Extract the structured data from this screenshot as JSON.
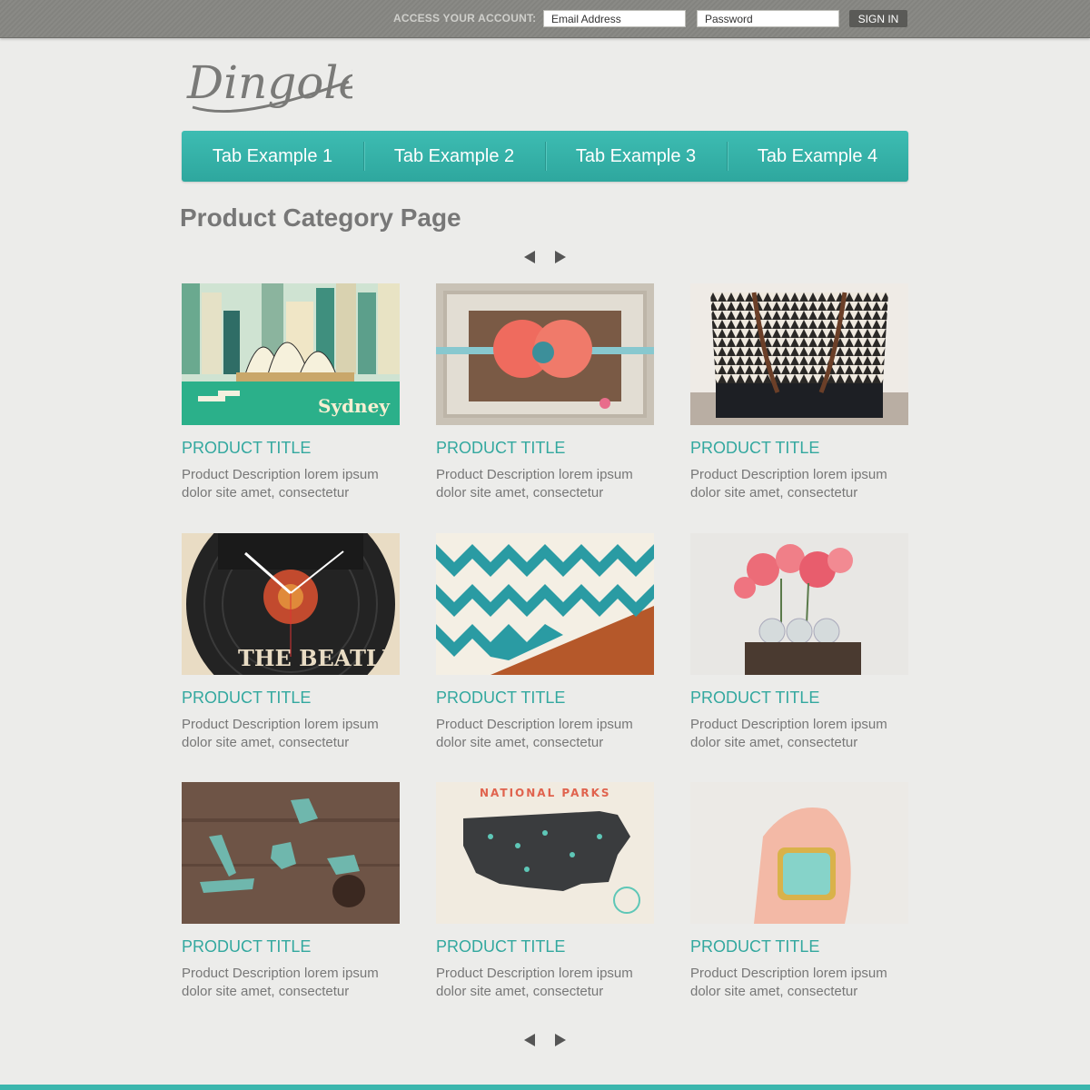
{
  "account": {
    "label": "ACCESS YOUR ACCOUNT:",
    "email_placeholder": "Email Address",
    "password_placeholder": "Password",
    "signin_label": "SIGN IN"
  },
  "brand": {
    "logo_text": "Dingolé"
  },
  "nav": {
    "tabs": [
      {
        "label": "Tab Example 1"
      },
      {
        "label": "Tab Example 2"
      },
      {
        "label": "Tab Example 3"
      },
      {
        "label": "Tab Example 4"
      }
    ]
  },
  "page": {
    "title": "Product Category Page"
  },
  "colors": {
    "accent": "#33a89f",
    "nav": "#35b2a8"
  },
  "products": [
    {
      "title": "PRODUCT TITLE",
      "desc": "Product Description lorem ipsum dolor site amet, consectetur",
      "image": "sydney-poster",
      "image_caption": "Sydney"
    },
    {
      "title": "PRODUCT TITLE",
      "desc": "Product Description lorem ipsum dolor site amet, consectetur",
      "image": "flower-headband"
    },
    {
      "title": "PRODUCT TITLE",
      "desc": "Product Description lorem ipsum dolor site amet, consectetur",
      "image": "tote-bag"
    },
    {
      "title": "PRODUCT TITLE",
      "desc": "Product Description lorem ipsum dolor site amet, consectetur",
      "image": "record-clock",
      "image_caption": "THE BEATLES"
    },
    {
      "title": "PRODUCT TITLE",
      "desc": "Product Description lorem ipsum dolor site amet, consectetur",
      "image": "chevron-fabric"
    },
    {
      "title": "PRODUCT TITLE",
      "desc": "Product Description lorem ipsum dolor site amet, consectetur",
      "image": "flowers-vases"
    },
    {
      "title": "PRODUCT TITLE",
      "desc": "Product Description lorem ipsum dolor site amet, consectetur",
      "image": "state-necklaces"
    },
    {
      "title": "PRODUCT TITLE",
      "desc": "Product Description lorem ipsum dolor site amet, consectetur",
      "image": "national-parks-map",
      "image_caption": "NATIONAL PARKS"
    },
    {
      "title": "PRODUCT TITLE",
      "desc": "Product Description lorem ipsum dolor site amet, consectetur",
      "image": "turquoise-ring"
    }
  ]
}
